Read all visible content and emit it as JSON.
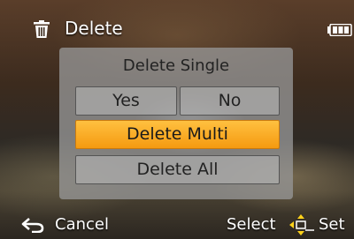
{
  "header": {
    "icon": "trash-icon",
    "title": "Delete",
    "battery_icon": "battery-icon"
  },
  "dialog": {
    "title": "Delete Single",
    "options": {
      "yes": "Yes",
      "no": "No",
      "delete_multi": "Delete Multi",
      "delete_all": "Delete All"
    },
    "selected": "Delete Multi",
    "highlight_color": "#f7a51f"
  },
  "footer": {
    "back_icon": "back-arrow-icon",
    "cancel": "Cancel",
    "select": "Select",
    "dpad_icon": "dpad-icon",
    "set": "Set"
  }
}
